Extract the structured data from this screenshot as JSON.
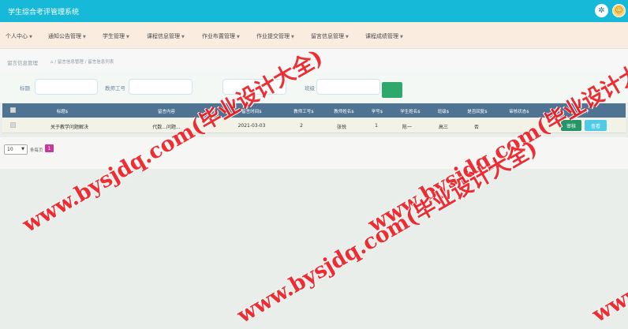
{
  "app": {
    "title": "学生综合考评管理系统"
  },
  "header": {
    "gear_icon": "gear-icon",
    "user_icon": "user-avatar-icon"
  },
  "nav": {
    "items": [
      {
        "label": "个人中心"
      },
      {
        "label": "通知公告管理"
      },
      {
        "label": "学生管理"
      },
      {
        "label": "课程信息管理"
      },
      {
        "label": "作业布置管理"
      },
      {
        "label": "作业提交管理"
      },
      {
        "label": "留言信息管理"
      },
      {
        "label": "课程成绩管理"
      }
    ]
  },
  "breadcrumb": {
    "title": "留言信息管理",
    "home_icon": "home-icon",
    "path": "/ 留言信息管理 / 留言信息列表"
  },
  "search": {
    "fields": [
      {
        "label": "标题",
        "value": ""
      },
      {
        "label": "教师工号",
        "value": ""
      },
      {
        "label": "",
        "value": ""
      },
      {
        "label": "班级",
        "value": ""
      }
    ],
    "button_icon": "search-icon"
  },
  "table": {
    "headers": [
      "标题$",
      "留言内容",
      "留言时间$",
      "教师工号$",
      "教师姓名$",
      "学号$",
      "学生姓名$",
      "班级$",
      "是否回复$",
      "审核状态$",
      "操作"
    ],
    "rows": [
      {
        "title": "关于教学问题解决",
        "content": "代数...问题...",
        "time": "2021-03-03",
        "teacher_id": "2",
        "teacher_name": "张悦",
        "student_id": "1",
        "student_name": "陈一",
        "class": "高三",
        "replied": "否",
        "status": "",
        "audit_label": "审核",
        "view_label": "查看"
      }
    ]
  },
  "pagination": {
    "page_size": "10",
    "total": "条每页",
    "current": "1"
  },
  "watermark": {
    "text": "www.bysjdq.com(毕业设计大全)"
  },
  "colors": {
    "header": "#16b9d8",
    "nav_bg": "#fbece0",
    "table_head": "#4f7392",
    "audit": "#24966a",
    "view": "#4fcbe8",
    "search": "#2ea86b",
    "page": "#c43b99",
    "watermark": "#ee1d23"
  }
}
